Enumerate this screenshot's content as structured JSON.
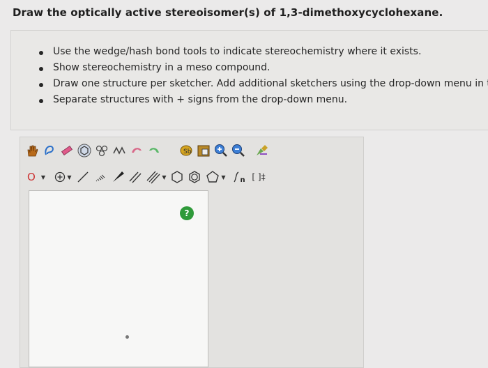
{
  "question": {
    "title": "Draw the optically active stereoisomer(s) of 1,3-dimethoxycyclohexane.",
    "instructions": [
      "Use the wedge/hash bond tools to indicate stereochemistry where it exists.",
      "Show stereochemistry in a meso compound.",
      "Draw one structure per sketcher. Add additional sketchers using the drop-down menu in t",
      "Separate structures with + signs from the drop-down menu."
    ]
  },
  "sketcher": {
    "atom_selector_value": "O",
    "help_label": "?",
    "toolbar_top_icons": [
      "hand-icon",
      "lasso-icon",
      "eraser-icon",
      "ring-template-icon",
      "atom-map-icon",
      "chain-icon",
      "undo-icon",
      "redo-icon",
      "copy-icon",
      "paste-icon",
      "zoom-in-icon",
      "zoom-out-icon",
      "clean-icon"
    ],
    "toolbar_second_icons": [
      "charge-icon",
      "single-bond-icon",
      "hash-bond-icon",
      "wedge-bond-icon",
      "double-bond-icon",
      "triple-bond-icon",
      "cyclohexane-icon",
      "benzene-icon",
      "cyclopentane-icon",
      "sgroup-icon",
      "bracket-icon"
    ],
    "sgroup_label": "n",
    "bracket_label": "[ ]‡"
  },
  "colors": {
    "accent_red": "#cc3333",
    "help_green": "#2f9a3a"
  }
}
